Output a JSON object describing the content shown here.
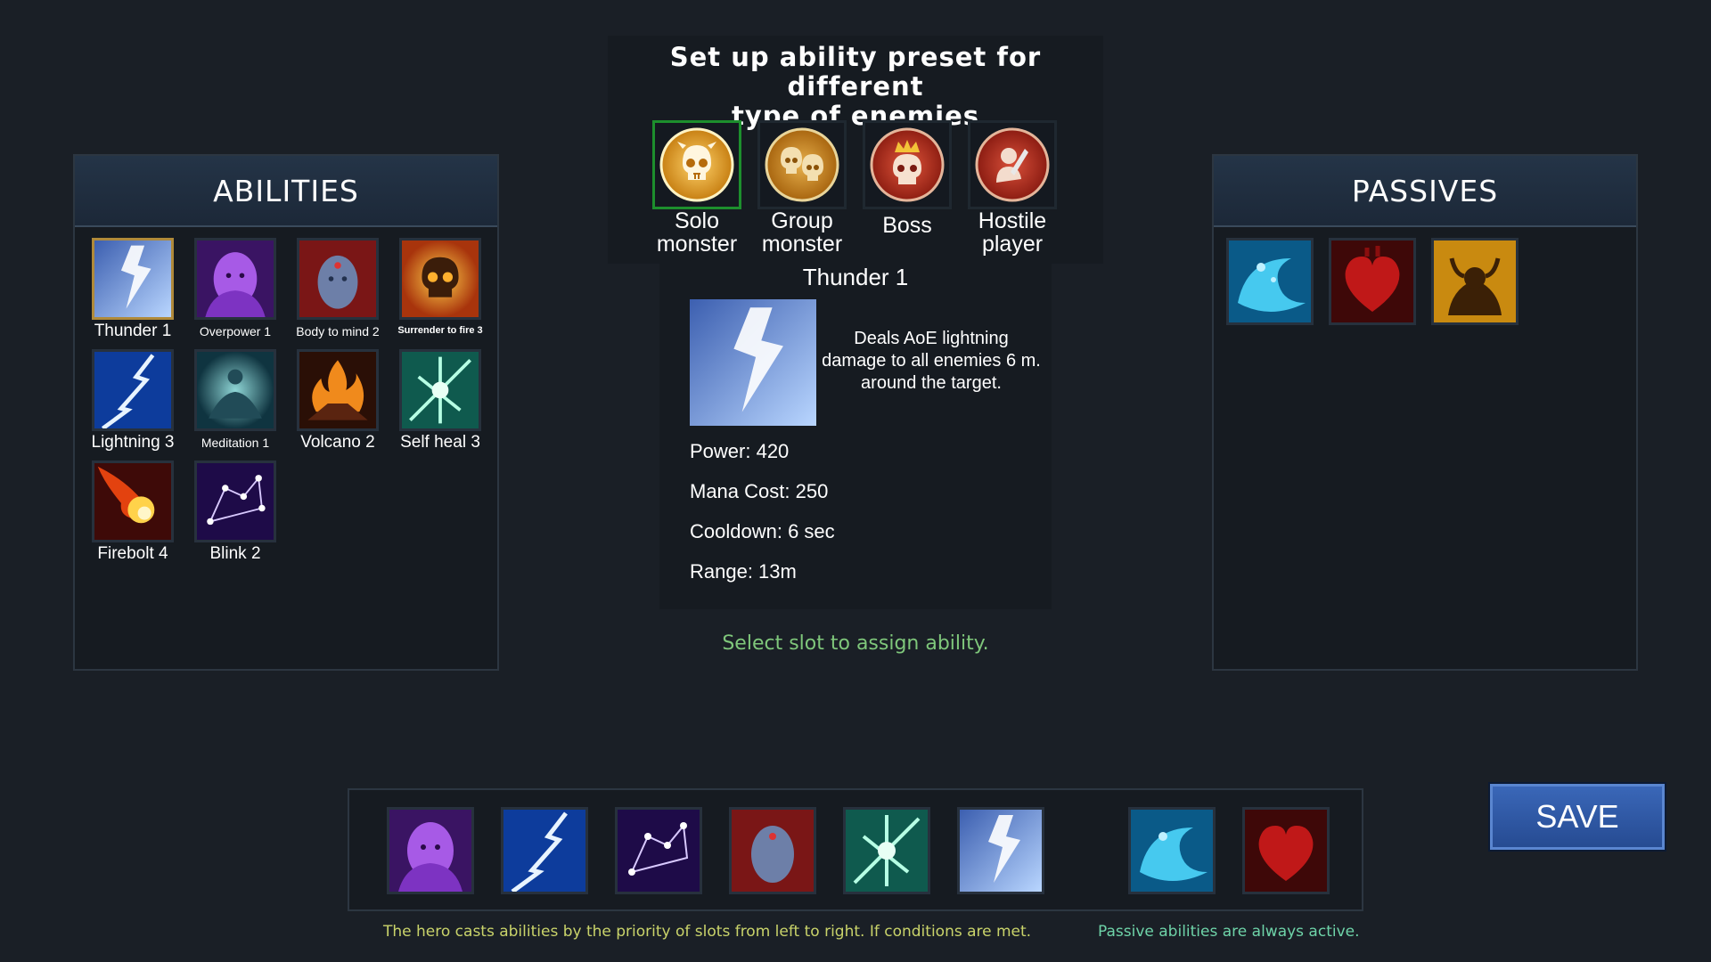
{
  "preset": {
    "title_line1": "Set up ability preset for different",
    "title_line2": "type of enemies",
    "options": [
      {
        "line1": "Solo",
        "line2": "monster",
        "icon": "solo-monster-skull-icon",
        "active": true
      },
      {
        "line1": "Group",
        "line2": "monster",
        "icon": "group-monster-icon",
        "active": false
      },
      {
        "line1": "Boss",
        "line2": "",
        "icon": "boss-crowned-skull-icon",
        "active": false
      },
      {
        "line1": "Hostile",
        "line2": "player",
        "icon": "hostile-player-knight-icon",
        "active": false
      }
    ]
  },
  "abilities": {
    "header": "ABILITIES",
    "items": [
      {
        "label": "Thunder 1",
        "icon": "thunder-icon",
        "selected": true
      },
      {
        "label": "Overpower 1",
        "icon": "overpower-icon"
      },
      {
        "label": "Body to mind 2",
        "icon": "body-to-mind-icon"
      },
      {
        "label": "Surrender to fire 3",
        "icon": "surrender-to-fire-icon"
      },
      {
        "label": "Lightning 3",
        "icon": "lightning-icon"
      },
      {
        "label": "Meditation 1",
        "icon": "meditation-icon"
      },
      {
        "label": "Volcano 2",
        "icon": "volcano-icon"
      },
      {
        "label": "Self heal 3",
        "icon": "self-heal-icon"
      },
      {
        "label": "Firebolt 4",
        "icon": "firebolt-icon"
      },
      {
        "label": "Blink 2",
        "icon": "blink-icon"
      }
    ]
  },
  "passives": {
    "header": "PASSIVES",
    "items": [
      {
        "icon": "water-swirl-icon"
      },
      {
        "icon": "heart-icon"
      },
      {
        "icon": "horned-beast-icon"
      }
    ]
  },
  "detail": {
    "name": "Thunder 1",
    "description": "Deals AoE lightning damage to all enemies 6 m. around the target.",
    "power": "Power: 420",
    "mana": "Mana Cost: 250",
    "cooldown": "Cooldown: 6 sec",
    "range": "Range: 13m"
  },
  "hint": "Select slot to assign ability.",
  "slots": [
    "overpower-icon",
    "lightning-icon",
    "blink-icon",
    "body-to-mind-icon",
    "self-heal-icon",
    "thunder-icon",
    "water-swirl-icon",
    "heart-icon"
  ],
  "save_label": "SAVE",
  "notes": {
    "left": "The hero casts abilities by the priority of slots from left to right. If conditions are met.",
    "right": "Passive abilities are always active."
  }
}
